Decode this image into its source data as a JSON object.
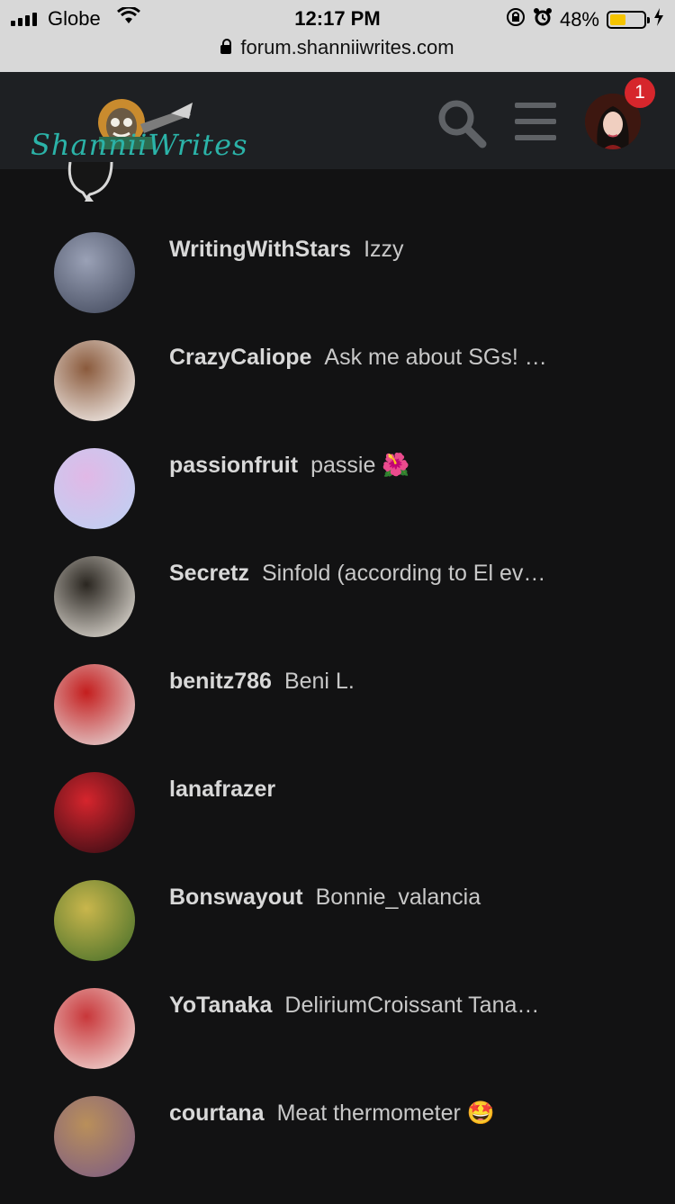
{
  "status_bar": {
    "carrier": "Globe",
    "time": "12:17 PM",
    "battery": "48%",
    "battery_level": 0.48
  },
  "browser": {
    "url": "forum.shanniiwrites.com"
  },
  "header": {
    "logo_text": "ShanniiWrites",
    "notification_count": "1",
    "colors": {
      "accent": "#2bb3a8",
      "badge": "#d6262c",
      "header_bg": "#1e2023",
      "page_bg": "#121213"
    }
  },
  "members": [
    {
      "username": "WritingWithStars",
      "title": "Izzy",
      "avatar_colors": [
        "#3c4356",
        "#9aa1b6"
      ]
    },
    {
      "username": "CrazyCaliope",
      "title": "Ask me about SGs! …",
      "avatar_colors": [
        "#ffffff",
        "#8a5a3c"
      ]
    },
    {
      "username": "passionfruit",
      "title": "passie 🌺",
      "avatar_colors": [
        "#bcd3f4",
        "#e1b8e6"
      ]
    },
    {
      "username": "Secretz",
      "title": "Sinfold (according to El ev…",
      "avatar_colors": [
        "#f3eee6",
        "#2a2620"
      ]
    },
    {
      "username": "benitz786",
      "title": "Beni L.",
      "avatar_colors": [
        "#e8e8e8",
        "#c41e1e"
      ]
    },
    {
      "username": "lanafrazer",
      "title": "",
      "avatar_colors": [
        "#2a0a12",
        "#d6252d"
      ]
    },
    {
      "username": "Bonswayout",
      "title": "Bonnie_valancia",
      "avatar_colors": [
        "#3f6b28",
        "#c9b64c"
      ]
    },
    {
      "username": "YoTanaka",
      "title": "DeliriumCroissant Tana…",
      "avatar_colors": [
        "#f4e8e4",
        "#c8373a"
      ]
    },
    {
      "username": "courtana",
      "title": "Meat thermometer 🤩",
      "avatar_colors": [
        "#7a5a86",
        "#b98f5a"
      ]
    }
  ]
}
